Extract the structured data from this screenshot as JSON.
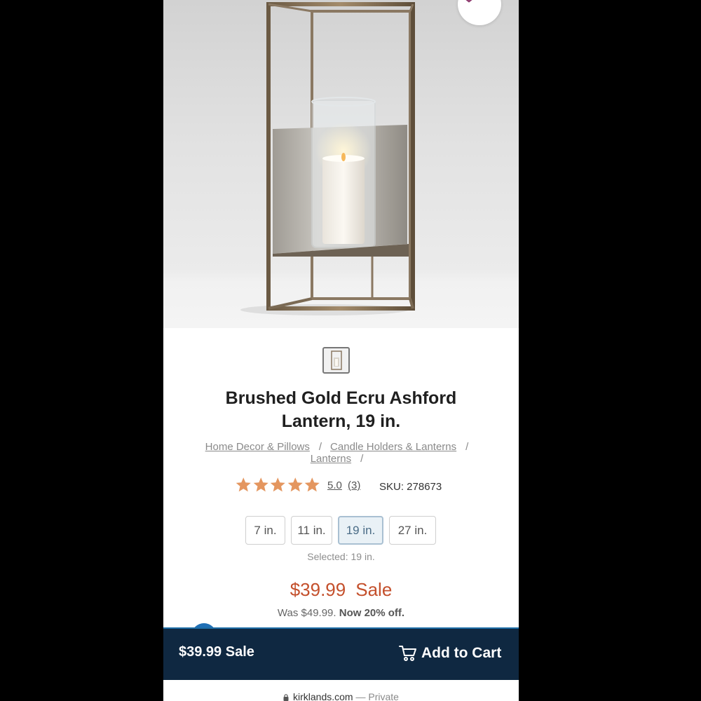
{
  "product": {
    "title_line1": "Brushed Gold Ecru Ashford",
    "title_line2": "Lantern, 19 in.",
    "image_icon": "lantern-photo",
    "favorite_icon": "heart-outline-icon"
  },
  "breadcrumb": {
    "items": [
      "Home Decor & Pillows",
      "Candle Holders & Lanterns",
      "Lanterns"
    ],
    "separator": "/"
  },
  "rating": {
    "stars": 5,
    "score": "5.0",
    "count": "(3)",
    "star_color": "#e4965f"
  },
  "sku": "SKU: 278673",
  "sizes": {
    "options": [
      "7 in.",
      "11 in.",
      "19 in.",
      "27 in."
    ],
    "selected_index": 2,
    "selected_text": "Selected: 19 in."
  },
  "pricing": {
    "sale_price": "$39.99",
    "sale_label": "Sale",
    "was_text": "Was $49.99.",
    "discount_text": "Now 20% off.",
    "price_color": "#c4502c"
  },
  "bottom_bar": {
    "price_text": "$39.99 Sale",
    "add_to_cart_label": "Add to Cart",
    "cart_icon": "cart-icon",
    "bg_color": "#0f2841"
  },
  "browser": {
    "domain": "kirklands.com",
    "mode": "— Private",
    "lock_icon": "lock-icon"
  }
}
